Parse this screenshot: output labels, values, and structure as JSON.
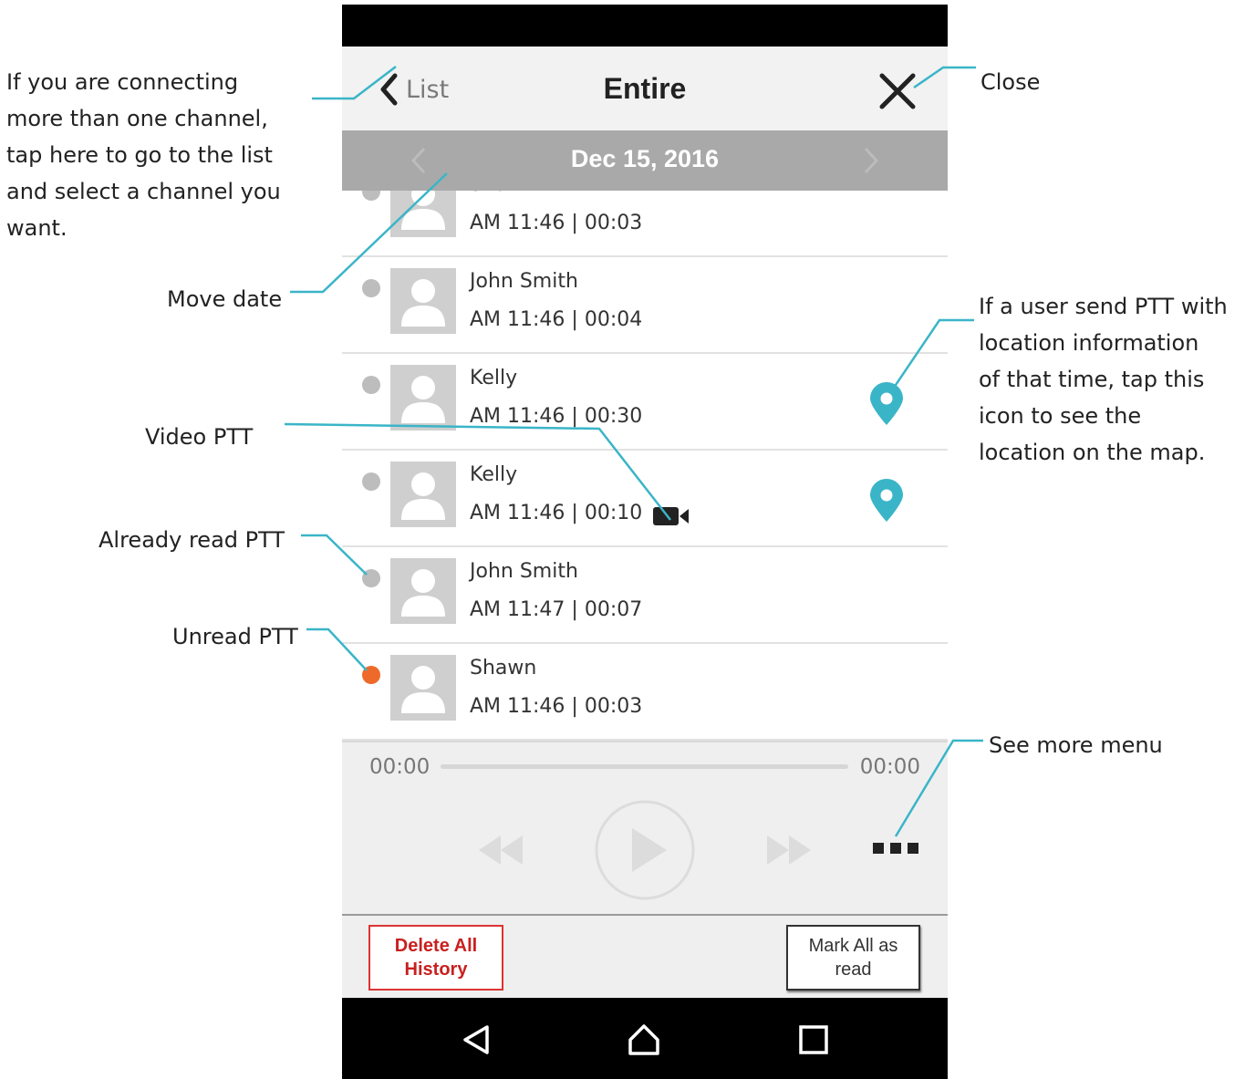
{
  "header": {
    "back_label": "List",
    "title": "Entire"
  },
  "date_bar": {
    "date": "Dec 15, 2016"
  },
  "list": [
    {
      "name": "Shawn",
      "meta": "AM 11:46 | 00:03",
      "read": true,
      "location": false,
      "video": false
    },
    {
      "name": "John Smith",
      "meta": "AM 11:46 | 00:04",
      "read": true,
      "location": false,
      "video": false
    },
    {
      "name": "Kelly",
      "meta": "AM 11:46 | 00:30",
      "read": true,
      "location": true,
      "video": false
    },
    {
      "name": "Kelly",
      "meta": "AM 11:46 | 00:10",
      "read": true,
      "location": true,
      "video": true
    },
    {
      "name": "John Smith",
      "meta": "AM 11:47 | 00:07",
      "read": true,
      "location": false,
      "video": false
    },
    {
      "name": "Shawn",
      "meta": "AM 11:46 | 00:03",
      "read": false,
      "location": false,
      "video": false
    }
  ],
  "player": {
    "time_current": "00:00",
    "time_total": "00:00"
  },
  "footer": {
    "delete_label": "Delete All History",
    "mark_label": "Mark All as read"
  },
  "annotations": {
    "list_lines": [
      "If you are connecting",
      "more than one channel,",
      "tap here to go to the list",
      "and select a channel you",
      "want."
    ],
    "close": "Close",
    "move_date": "Move date",
    "video_ptt": "Video PTT",
    "already_read": "Already read PTT",
    "unread": "Unread PTT",
    "location_lines": [
      "If a user send PTT with",
      "location information",
      "of that time, tap this",
      "icon to see the",
      "location on the map."
    ],
    "more_menu": "See more menu"
  },
  "colors": {
    "accent_teal": "#3ab5c8",
    "unread_dot": "#ee6a2b",
    "read_dot": "#bdbdbd",
    "delete_red": "#c8201f",
    "date_bar": "#a9a9a9"
  },
  "icons": [
    "chevron-left-icon",
    "close-icon",
    "location-pin-icon",
    "video-camera-icon",
    "rewind-icon",
    "play-icon",
    "fast-forward-icon",
    "more-icon",
    "nav-back-icon",
    "nav-home-icon",
    "nav-recents-icon"
  ]
}
